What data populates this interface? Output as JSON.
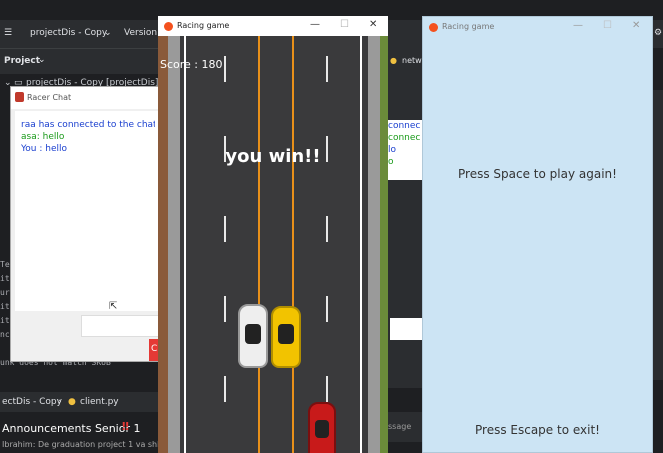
{
  "ide": {
    "project_name": "projectDis - Copy",
    "version_menu": "Version c",
    "project_label": "Project",
    "tree_root": "projectDis - Copy [projectDis]",
    "terminal_label": "Te",
    "terminal_lines": [
      "it",
      "ur",
      "it",
      "it",
      "nc"
    ],
    "terminal_error": "unk does not match SKUB",
    "breadcrumb_project": "ectDis - Copy",
    "breadcrumb_file": "client.py",
    "right_tab": "netw",
    "right_chat_lines": [
      "connec",
      "connec",
      "lo",
      "o"
    ],
    "right_message": "ssage",
    "announcement_title": "Announcements Senior 1",
    "announcement_sub": "Ibrahim: De graduation project 1 va shh"
  },
  "chat": {
    "title": "Racer Chat",
    "messages": [
      {
        "text": "raa has connected to the chat r",
        "color": "#1a3fcf"
      },
      {
        "text": "asa: hello",
        "color": "#1a9a1a"
      },
      {
        "text": "You : hello",
        "color": "#1a3fcf"
      }
    ],
    "send_label": "C"
  },
  "race_left": {
    "title": "Racing game",
    "score": "Score : 180",
    "win_text": "you win!!"
  },
  "race_right": {
    "title": "Racing game",
    "msg_play": "Press Space to play again!",
    "msg_exit": "Press Escape to exit!"
  },
  "icons": {
    "minimize": "—",
    "maximize": "☐",
    "close": "✕"
  },
  "colors": {
    "accent_red": "#f4511e",
    "car_white": "#eeeeee",
    "car_yellow": "#f2c300",
    "car_red": "#c81a1a"
  }
}
